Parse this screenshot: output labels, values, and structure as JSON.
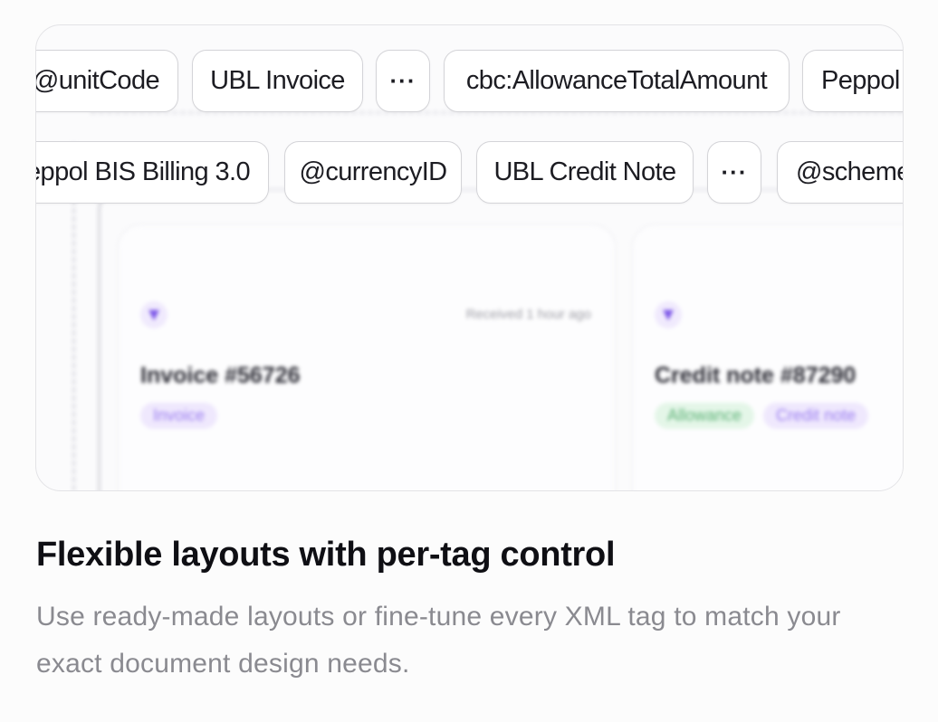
{
  "row1_chips": [
    {
      "label": "@unitCode"
    },
    {
      "label": "UBL Invoice"
    },
    {
      "label": "···"
    },
    {
      "label": "cbc:AllowanceTotalAmount"
    },
    {
      "label": "Peppol"
    }
  ],
  "row2_chips": [
    {
      "label": "eppol BIS Billing 3.0"
    },
    {
      "label": "@currencyID"
    },
    {
      "label": "UBL Credit Note"
    },
    {
      "label": "···"
    },
    {
      "label": "@scheme"
    }
  ],
  "cards": [
    {
      "received": "Received 1 hour ago",
      "title": "Invoice #56726",
      "tags": [
        "Invoice"
      ]
    },
    {
      "title": "Credit note #87290",
      "tags": [
        "Allowance",
        "Credit note"
      ]
    }
  ],
  "heading": "Flexible layouts with per-tag control",
  "description": "Use ready-made layouts or fine-tune every XML tag to match your exact document design needs.",
  "colors": {
    "accent": "#7b55e8",
    "text": "#0f0f14",
    "muted": "#8a8a90"
  }
}
